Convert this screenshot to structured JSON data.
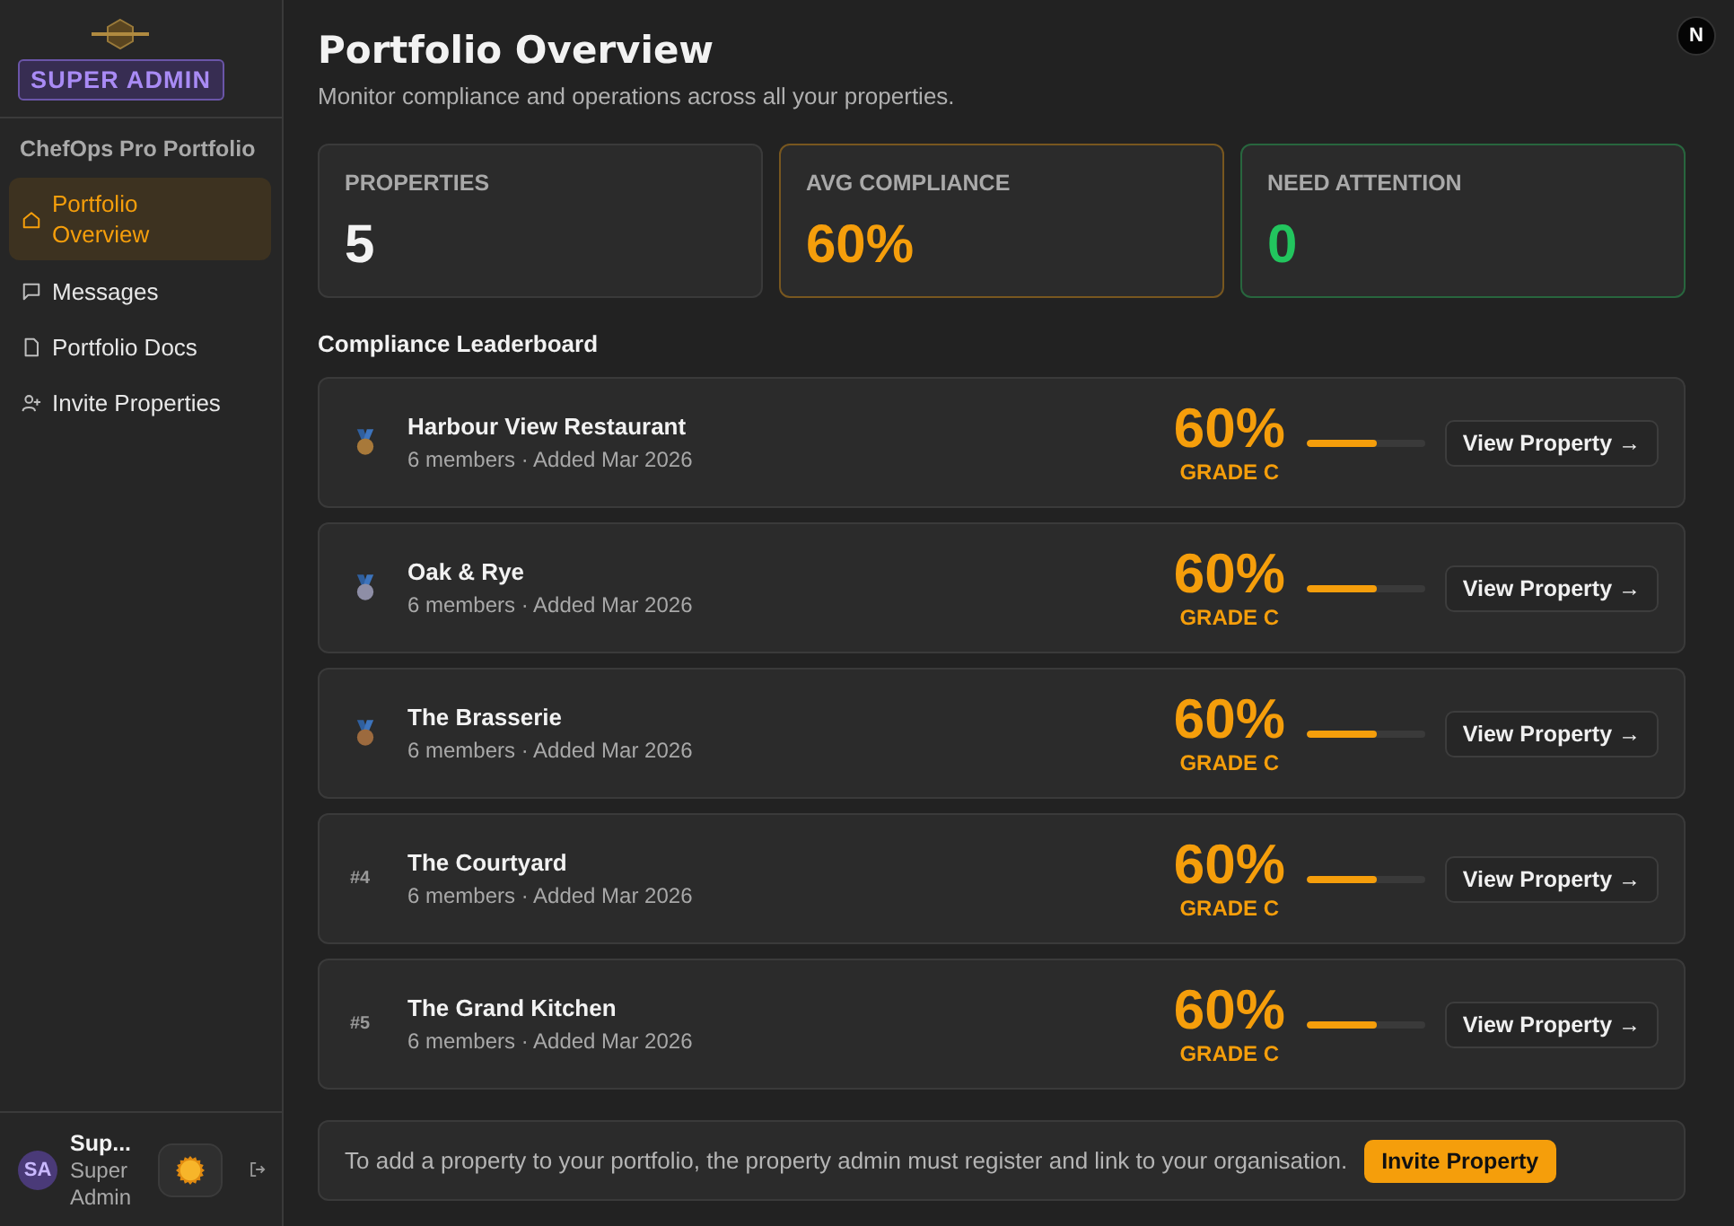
{
  "sidebar": {
    "badge": "SUPER ADMIN",
    "section_title": "ChefOps Pro Portfolio",
    "items": [
      {
        "label": "Portfolio Overview",
        "selected": true
      },
      {
        "label": "Messages",
        "selected": false
      },
      {
        "label": "Portfolio Docs",
        "selected": false
      },
      {
        "label": "Invite Properties",
        "selected": false
      }
    ],
    "user": {
      "initials": "SA",
      "name": "Sup...",
      "role": "Super Admin"
    }
  },
  "header": {
    "title": "Portfolio Overview",
    "subtitle": "Monitor compliance and operations across all your properties.",
    "dev_indicator": "N"
  },
  "stats": [
    {
      "label": "PROPERTIES",
      "value": "5",
      "color": "#f3f3f3",
      "highlighted": false
    },
    {
      "label": "AVG COMPLIANCE",
      "value": "60%",
      "color": "#f59e0b",
      "highlighted": true
    },
    {
      "label": "NEED ATTENTION",
      "value": "0",
      "color": "#22c55e",
      "highlighted": true
    }
  ],
  "leaderboard": {
    "title": "Compliance Leaderboard",
    "rows": [
      {
        "kind": "medal",
        "color": "#a8793a",
        "name": "Harbour View Restaurant",
        "details": "6 members · Added Mar 2026",
        "score": "60%",
        "grade": "GRADE C",
        "level": 0.6,
        "action": "View Property →"
      },
      {
        "kind": "medal",
        "color": "#8e8ea6",
        "name": "Oak & Rye",
        "details": "6 members · Added Mar 2026",
        "score": "60%",
        "grade": "GRADE C",
        "level": 0.6,
        "action": "View Property →"
      },
      {
        "kind": "medal",
        "color": "#9c6a3e",
        "name": "The Brasserie",
        "details": "6 members · Added Mar 2026",
        "score": "60%",
        "grade": "GRADE C",
        "level": 0.6,
        "action": "View Property →"
      },
      {
        "kind": "number",
        "rank": "#4",
        "name": "The Courtyard",
        "details": "6 members · Added Mar 2026",
        "score": "60%",
        "grade": "GRADE C",
        "level": 0.6,
        "action": "View Property →"
      },
      {
        "kind": "number",
        "rank": "#5",
        "name": "The Grand Kitchen",
        "details": "6 members · Added Mar 2026",
        "score": "60%",
        "grade": "GRADE C",
        "level": 0.6,
        "action": "View Property →"
      }
    ]
  },
  "info_banner": {
    "text": "To add a property to your portfolio, the property admin must register and link to your organisation.",
    "button": "Invite Property"
  }
}
